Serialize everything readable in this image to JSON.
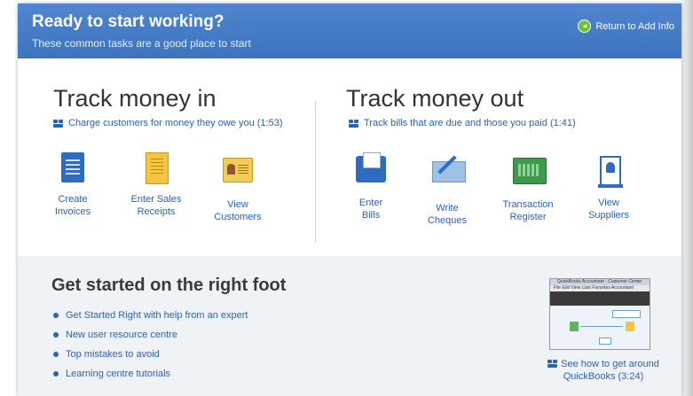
{
  "header": {
    "title": "Ready to start working?",
    "subtitle": "These common tasks are a good place to start",
    "return_link": "Return to Add Info"
  },
  "money_in": {
    "title": "Track money in",
    "video_link": "Charge customers for money they owe you (1:53)",
    "tasks": [
      {
        "line1": "Create",
        "line2": "Invoices",
        "icon": "invoice-icon"
      },
      {
        "line1": "Enter Sales",
        "line2": "Receipts",
        "icon": "sales-receipt-icon"
      },
      {
        "line1": "View",
        "line2": "Customers",
        "icon": "customer-card-icon"
      }
    ]
  },
  "money_out": {
    "title": "Track money out",
    "video_link": "Track bills that are due and those you paid (1:41)",
    "tasks": [
      {
        "line1": "Enter",
        "line2": "Bills",
        "icon": "bill-envelope-icon"
      },
      {
        "line1": "Write",
        "line2": "Cheques",
        "icon": "cheque-pen-icon"
      },
      {
        "line1": "Transaction",
        "line2": "Register",
        "icon": "register-icon"
      },
      {
        "line1": "View",
        "line2": "Suppliers",
        "icon": "supplier-icon"
      }
    ]
  },
  "getting_started": {
    "title": "Get started on the right foot",
    "links": [
      "Get Started Right with help from an expert",
      "New user resource centre",
      "Top mistakes to avoid",
      "Learning centre tutorials"
    ],
    "thumbnail": {
      "window_title": "QuickBooks Accountant - Customer Center",
      "menu": "File  Edit  View  Lists  Favorites  Accountant"
    },
    "video_link_line1": "See how to get around",
    "video_link_line2": "QuickBooks (3:24)"
  }
}
